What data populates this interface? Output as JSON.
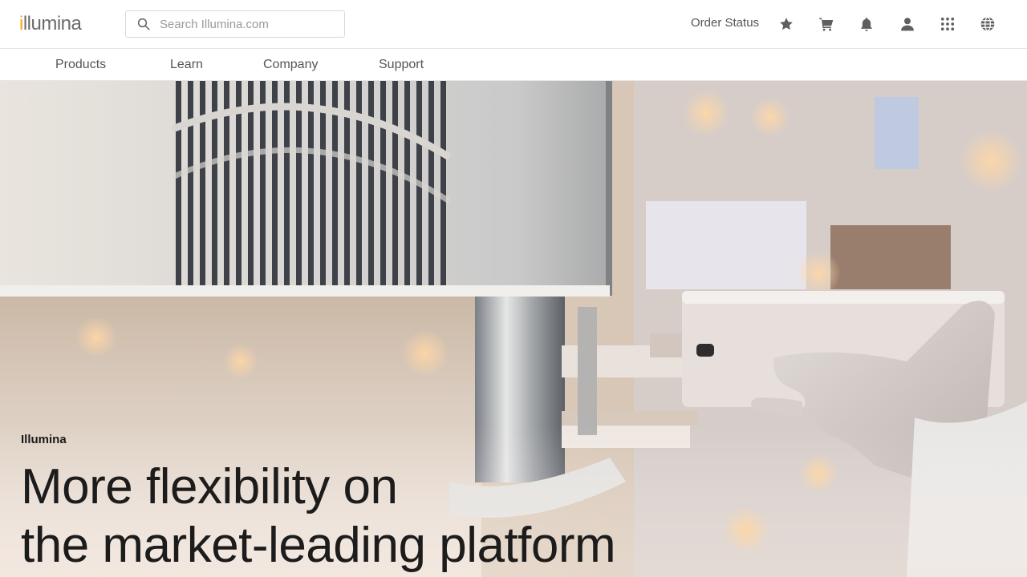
{
  "header": {
    "logo_first": "i",
    "logo_rest": "llumina",
    "search_placeholder": "Search Illumina.com",
    "order_status": "Order Status",
    "icons": [
      "star-icon",
      "cart-icon",
      "bell-icon",
      "user-icon",
      "apps-grid-icon",
      "globe-icon"
    ]
  },
  "nav": {
    "items": [
      {
        "label": "Products"
      },
      {
        "label": "Learn"
      },
      {
        "label": "Company"
      },
      {
        "label": "Support"
      }
    ]
  },
  "hero": {
    "eyebrow": "Illumina",
    "headline_line1": "More flexibility on",
    "headline_line2": "the market-leading platform"
  },
  "colors": {
    "brand_orange": "#f3a712",
    "logo_gray": "#6b6b6b",
    "icon_gray": "#5f5f5f",
    "nav_text": "#555555"
  }
}
